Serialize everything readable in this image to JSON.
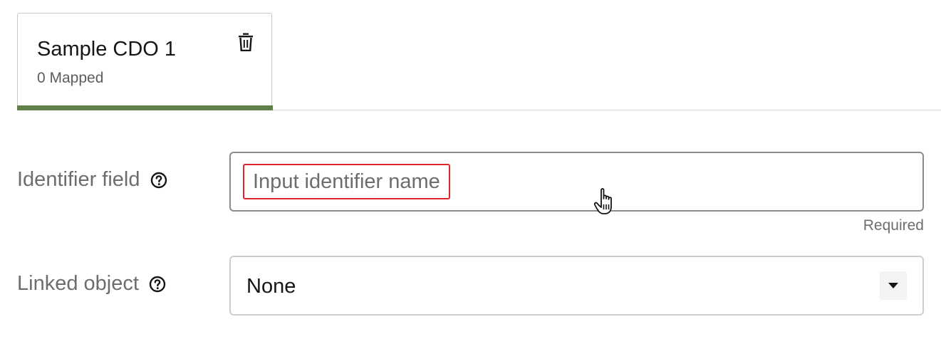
{
  "tab": {
    "title": "Sample CDO 1",
    "subtitle": "0 Mapped",
    "delete_icon": "trash-icon",
    "indicator_color": "#5e7e4a"
  },
  "form": {
    "identifier": {
      "label": "Identifier field",
      "help_icon": "question-circle-icon",
      "placeholder": "Input identifier name",
      "helper": "Required",
      "highlight_color": "#e0242b"
    },
    "linked_object": {
      "label": "Linked object",
      "help_icon": "question-circle-icon",
      "value": "None",
      "arrow_icon": "caret-down-icon"
    }
  },
  "cursor": "hand-pointer-icon"
}
